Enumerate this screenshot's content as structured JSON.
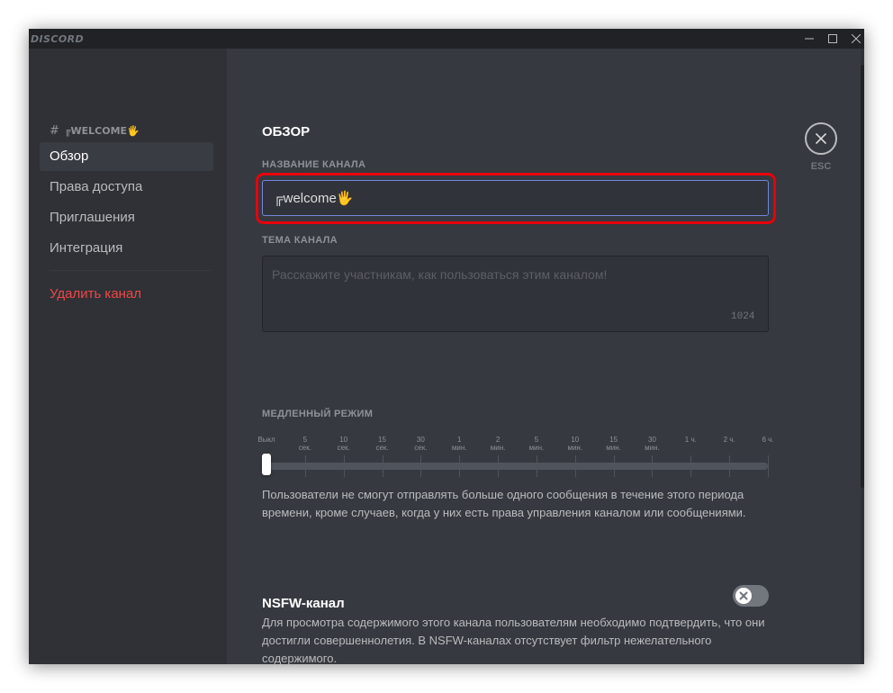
{
  "titlebar": {
    "app_name": "DISCORD"
  },
  "sidebar": {
    "channel_header": "╔welcome🖐",
    "channel_hash": "#",
    "items": [
      {
        "label": "Обзор",
        "active": true
      },
      {
        "label": "Права доступа"
      },
      {
        "label": "Приглашения"
      },
      {
        "label": "Интеграция"
      }
    ],
    "delete_label": "Удалить канал"
  },
  "overview": {
    "title": "ОБЗОР",
    "name_label": "НАЗВАНИЕ КАНАЛА",
    "name_value": "╔welcome🖐",
    "topic_label": "ТЕМА КАНАЛА",
    "topic_placeholder": "Расскажите участникам, как пользоваться этим каналом!",
    "topic_counter": "1024"
  },
  "slowmode": {
    "label": "МЕДЛЕННЫЙ РЕЖИМ",
    "ticks": [
      {
        "top": "Выкл",
        "bottom": ""
      },
      {
        "top": "5",
        "bottom": "сек."
      },
      {
        "top": "10",
        "bottom": "сек."
      },
      {
        "top": "15",
        "bottom": "сек."
      },
      {
        "top": "30",
        "bottom": "сек."
      },
      {
        "top": "1",
        "bottom": "мин."
      },
      {
        "top": "2",
        "bottom": "мин."
      },
      {
        "top": "5",
        "bottom": "мин."
      },
      {
        "top": "10",
        "bottom": "мин."
      },
      {
        "top": "15",
        "bottom": "мин."
      },
      {
        "top": "30",
        "bottom": "мин."
      },
      {
        "top": "1 ч.",
        "bottom": ""
      },
      {
        "top": "2 ч.",
        "bottom": ""
      },
      {
        "top": "6 ч.",
        "bottom": ""
      }
    ],
    "selected_index": 0,
    "description": "Пользователи не смогут отправлять больше одного сообщения в течение этого периода времени, кроме случаев, когда у них есть права управления каналом или сообщениями."
  },
  "nsfw": {
    "title": "NSFW-канал",
    "enabled": false,
    "description": "Для просмотра содержимого этого канала пользователям необходимо подтвердить, что они достигли совершеннолетия. В NSFW-каналах отсутствует фильтр нежелательного содержимого."
  },
  "close": {
    "esc_label": "ESC"
  },
  "colors": {
    "accent": "#7289da",
    "danger": "#f04747",
    "highlight": "#e8000b"
  },
  "icons": [
    "minimize-icon",
    "maximize-icon",
    "close-window-icon",
    "close-icon",
    "x-icon"
  ]
}
